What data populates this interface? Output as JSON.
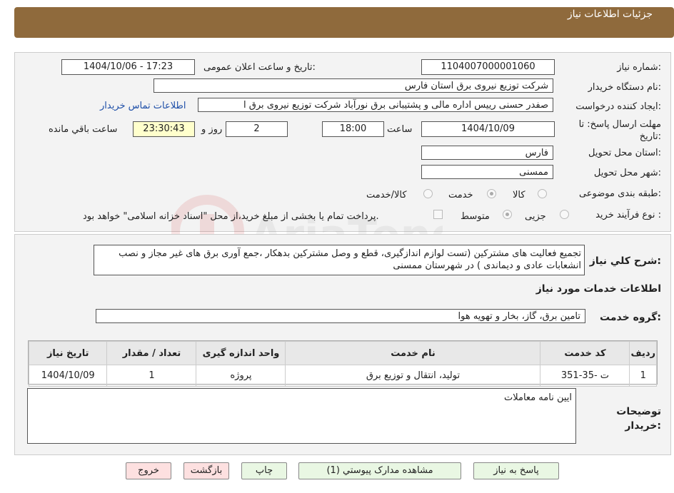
{
  "header": {
    "title": "جزئيات اطلاعات نياز"
  },
  "fields": {
    "need_number_label": "شماره نیاز:",
    "need_number": "1104007000001060",
    "announce_label": "تاریخ و ساعت اعلان عمومی:",
    "announce_value": "1404/10/06 - 17:23",
    "buyer_org_label": "نام دستگاه خریدار:",
    "buyer_org": "شرکت توزیع نیروی برق استان فارس",
    "requester_label": "ایجاد کننده درخواست:",
    "requester": "صفدر حسنی رییس اداره مالی و پشتیبانی برق نورآباد شرکت توزیع نیروی برق ا",
    "contact_link": "اطلاعات تماس خریدار",
    "deadline_label": "مهلت ارسال پاسخ: تا تاریخ:",
    "deadline_date": "1404/10/09",
    "time_label": "ساعت",
    "deadline_time": "18:00",
    "days_value": "2",
    "days_label": "روز و",
    "remaining_time": "23:30:43",
    "remaining_label": "ساعت باقي مانده",
    "province_label": "استان محل تحویل:",
    "province": "فارس",
    "city_label": "شهر محل تحویل:",
    "city": "ممسنی",
    "category_label": "طبقه بندی موضوعی:",
    "category_options": [
      "کالا",
      "خدمت",
      "کالا/خدمت"
    ],
    "process_label": "نوع فرآیند خرید :",
    "process_options": [
      "جزیی",
      "متوسط"
    ],
    "payment_note": "پرداخت تمام یا بخشی از مبلغ خرید،از محل \"اسناد خزانه اسلامی\" خواهد بود."
  },
  "summary": {
    "label": "شرح کلي نياز:",
    "text": "تجمیع فعالیت های مشترکین (تست لوازم اندازگیری، قطع و وصل مشترکین بدهکار ،جمع آوری برق های غیر مجاز و نصب انشعابات عادی و دیماندی ) در شهرستان ممسنی"
  },
  "services": {
    "title": "اطلاعات خدمات مورد نياز",
    "group_label": "گروه خدمت:",
    "group_value": "تامین برق، گاز، بخار و تهویه هوا",
    "columns": [
      "رديف",
      "کد خدمت",
      "نام خدمت",
      "واحد اندازه گیری",
      "تعداد / مقدار",
      "تاریخ نیاز"
    ],
    "rows": [
      [
        "1",
        "ت -35-351",
        "تولید، انتقال و توزیع برق",
        "پروژه",
        "1",
        "1404/10/09"
      ]
    ]
  },
  "notes": {
    "label": "توضیحات خریدار:",
    "text": "ایین نامه معاملات"
  },
  "buttons": {
    "reply": "پاسخ به نیاز",
    "attachments": "مشاهده مدارک پیوستي (1)",
    "print": "چاپ",
    "back": "بازگشت",
    "exit": "خروج"
  }
}
